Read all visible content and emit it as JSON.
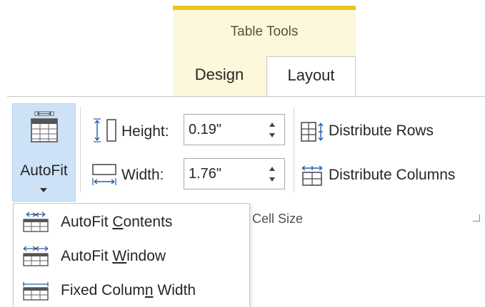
{
  "contextual_tab_group": {
    "label": "Table Tools",
    "accent_color": "#e8c51c",
    "background_color": "#fdf7dc"
  },
  "tabs": [
    {
      "label": "Design",
      "selected": false
    },
    {
      "label": "Layout",
      "selected": true
    }
  ],
  "autofit": {
    "label": "AutoFit",
    "pressed": true,
    "pressed_color": "#cde2f7",
    "icon": "autofit-table-icon"
  },
  "cell_size": {
    "height": {
      "label": "Height:",
      "value": "0.19\"",
      "icon": "row-height-icon"
    },
    "width": {
      "label": "Width:",
      "value": "1.76\"",
      "icon": "column-width-icon"
    },
    "distribute_rows": {
      "label": "Distribute Rows",
      "icon": "distribute-rows-icon"
    },
    "distribute_columns": {
      "label": "Distribute Columns",
      "icon": "distribute-columns-icon"
    },
    "group_label": "Cell Size"
  },
  "autofit_menu": [
    {
      "pre": "AutoFit ",
      "accel": "C",
      "post": "ontents",
      "icon": "autofit-contents-icon"
    },
    {
      "pre": "AutoFit ",
      "accel": "W",
      "post": "indow",
      "icon": "autofit-window-icon"
    },
    {
      "pre": "Fixed Colum",
      "accel": "n",
      "post": " Width",
      "icon": "fixed-column-width-icon"
    }
  ]
}
